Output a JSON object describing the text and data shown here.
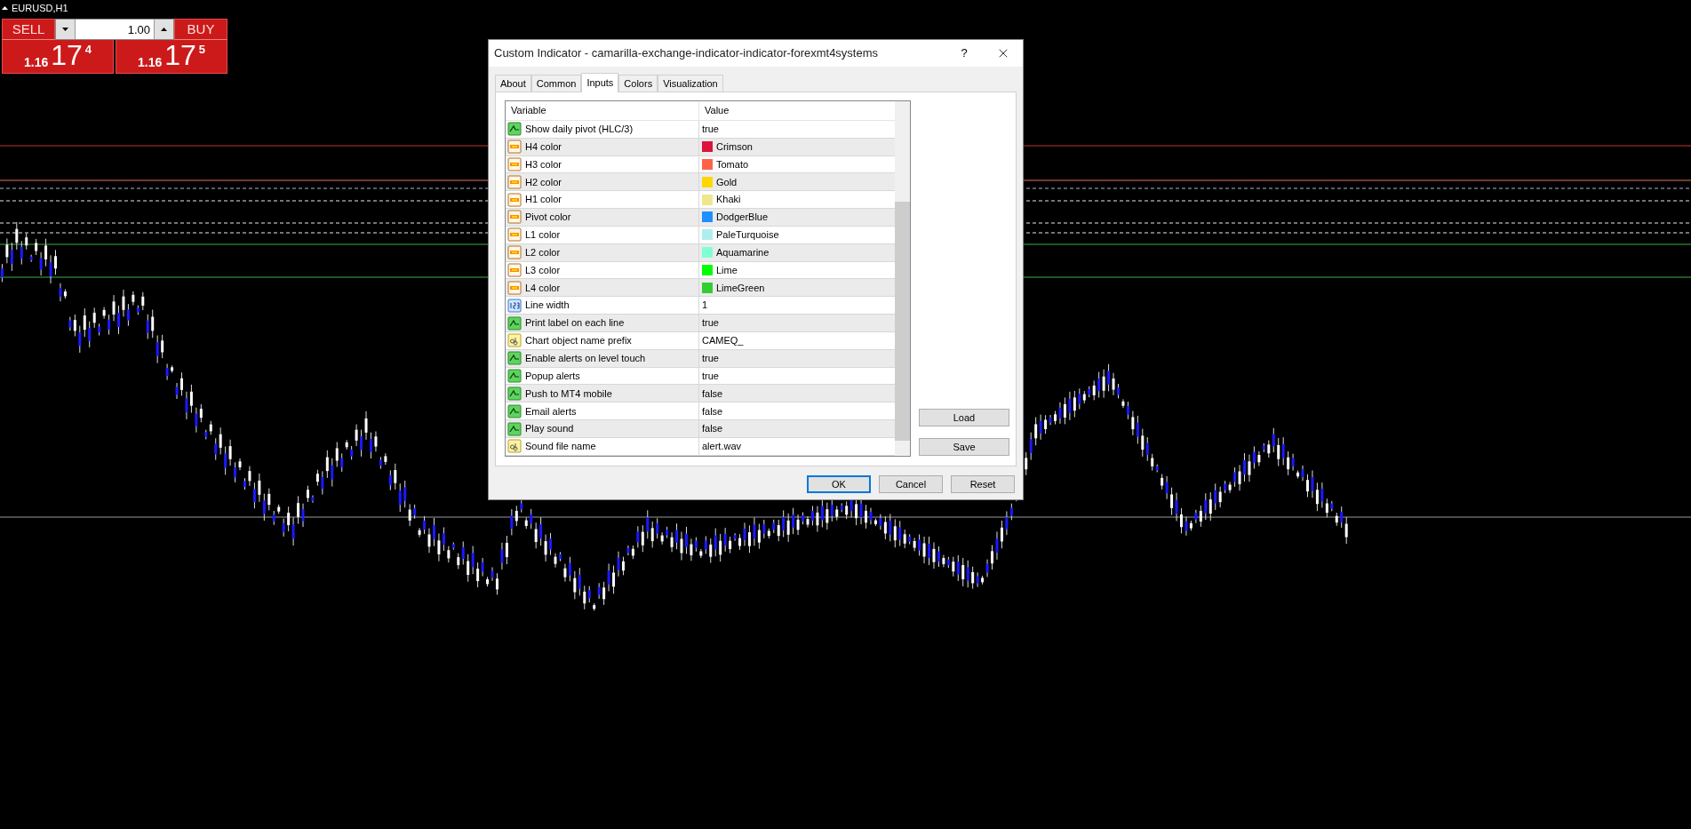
{
  "chart": {
    "symbol": "EURUSD,H1"
  },
  "trade_panel": {
    "quantity": "1.00",
    "sell": {
      "label": "SELL",
      "price_prefix": "1.16",
      "price_main": "17",
      "price_super": "4"
    },
    "buy": {
      "label": "BUY",
      "price_prefix": "1.16",
      "price_main": "17",
      "price_super": "5"
    }
  },
  "dialog": {
    "title": "Custom Indicator - camarilla-exchange-indicator-indicator-forexmt4systems",
    "help": "?",
    "tabs": [
      {
        "label": "About",
        "selected": false
      },
      {
        "label": "Common",
        "selected": false
      },
      {
        "label": "Inputs",
        "selected": true
      },
      {
        "label": "Colors",
        "selected": false
      },
      {
        "label": "Visualization",
        "selected": false
      }
    ],
    "table": {
      "columns": [
        "Variable",
        "Value"
      ],
      "rows": [
        {
          "kind": "bool",
          "variable": "Show daily pivot (HLC/3)",
          "value": "true"
        },
        {
          "kind": "color",
          "variable": "H4 color",
          "value": "Crimson",
          "color": "#dc143c"
        },
        {
          "kind": "color",
          "variable": "H3 color",
          "value": "Tomato",
          "color": "#ff6347"
        },
        {
          "kind": "color",
          "variable": "H2 color",
          "value": "Gold",
          "color": "#ffd700"
        },
        {
          "kind": "color",
          "variable": "H1 color",
          "value": "Khaki",
          "color": "#f0e68c"
        },
        {
          "kind": "color",
          "variable": "Pivot color",
          "value": "DodgerBlue",
          "color": "#1e90ff"
        },
        {
          "kind": "color",
          "variable": "L1 color",
          "value": "PaleTurquoise",
          "color": "#afeeee"
        },
        {
          "kind": "color",
          "variable": "L2 color",
          "value": "Aquamarine",
          "color": "#7fffd4"
        },
        {
          "kind": "color",
          "variable": "L3 color",
          "value": "Lime",
          "color": "#00ff00"
        },
        {
          "kind": "color",
          "variable": "L4 color",
          "value": "LimeGreen",
          "color": "#32cd32"
        },
        {
          "kind": "int",
          "variable": "Line width",
          "value": "1"
        },
        {
          "kind": "bool",
          "variable": "Print label on each line",
          "value": "true"
        },
        {
          "kind": "string",
          "variable": "Chart object name prefix",
          "value": "CAMEQ_"
        },
        {
          "kind": "bool",
          "variable": "Enable alerts on level touch",
          "value": "true"
        },
        {
          "kind": "bool",
          "variable": "Popup alerts",
          "value": "true"
        },
        {
          "kind": "bool",
          "variable": "Push to MT4 mobile",
          "value": "false"
        },
        {
          "kind": "bool",
          "variable": "Email alerts",
          "value": "false"
        },
        {
          "kind": "bool",
          "variable": "Play sound",
          "value": "false"
        },
        {
          "kind": "string",
          "variable": "Sound file name",
          "value": "alert.wav"
        }
      ]
    },
    "side_buttons": [
      "Load",
      "Save"
    ],
    "buttons": [
      {
        "label": "OK",
        "default": true
      },
      {
        "label": "Cancel",
        "default": false
      },
      {
        "label": "Reset",
        "default": false
      }
    ]
  }
}
